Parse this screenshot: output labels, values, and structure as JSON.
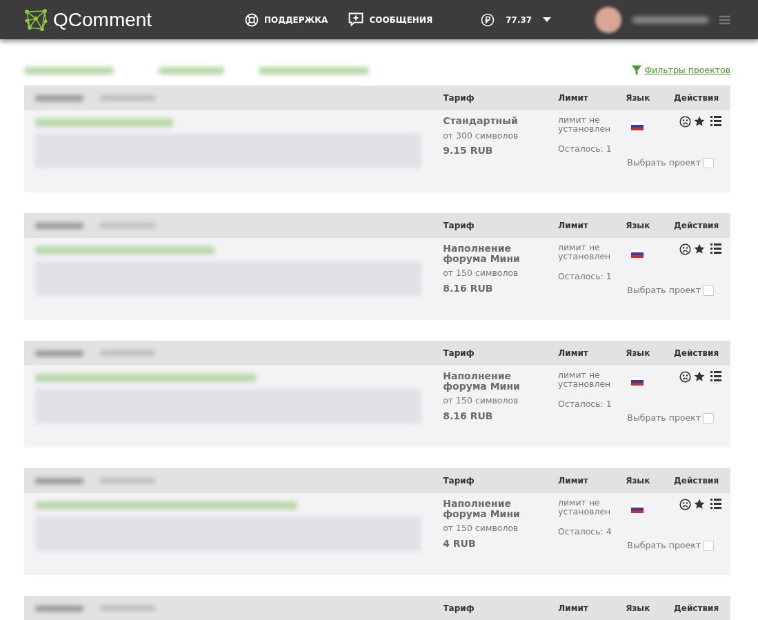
{
  "navbar": {
    "logo": "QComment",
    "links": [
      {
        "label": "ПОДДЕРЖКА",
        "kind": "support"
      },
      {
        "label": "СООБЩЕНИЯ",
        "kind": "messages"
      }
    ],
    "balance": "77.37"
  },
  "filter_link": "Фильтры проектов",
  "projects": [
    {
      "kind": "full",
      "columns": [
        "Тариф",
        "Лимит",
        "Язык",
        "Действия"
      ],
      "tariff": "Стандартный",
      "chars": "от 300 символов",
      "price": "9.15 RUB",
      "limit": "лимит не установлен",
      "remaining": "Осталось: 1",
      "select_label": "Выбрать проект",
      "checked": false
    },
    {
      "kind": "full",
      "columns": [
        "Тариф",
        "Лимит",
        "Язык",
        "Действия"
      ],
      "tariff": "Наполнение форума Мини",
      "chars": "от 150 символов",
      "price": "8.16 RUB",
      "limit": "лимит не установлен",
      "remaining": "Осталось: 1",
      "select_label": "Выбрать проект",
      "checked": false
    },
    {
      "kind": "full",
      "columns": [
        "Тариф",
        "Лимит",
        "Язык",
        "Действия"
      ],
      "tariff": "Наполнение форума Мини",
      "chars": "от 150 символов",
      "price": "8.16 RUB",
      "limit": "лимит не установлен",
      "remaining": "Осталось: 1",
      "select_label": "Выбрать проект",
      "checked": false
    },
    {
      "kind": "full",
      "columns": [
        "Тариф",
        "Лимит",
        "Язык",
        "Действия"
      ],
      "tariff": "Наполнение форума Мини",
      "chars": "от 150 символов",
      "price": "4 RUB",
      "limit": "лимит не установлен",
      "remaining": "Осталось: 4",
      "select_label": "Выбрать проект",
      "checked": false
    },
    {
      "kind": "header_only",
      "columns": [
        "Тариф",
        "Лимит",
        "Язык",
        "Действия"
      ]
    }
  ]
}
